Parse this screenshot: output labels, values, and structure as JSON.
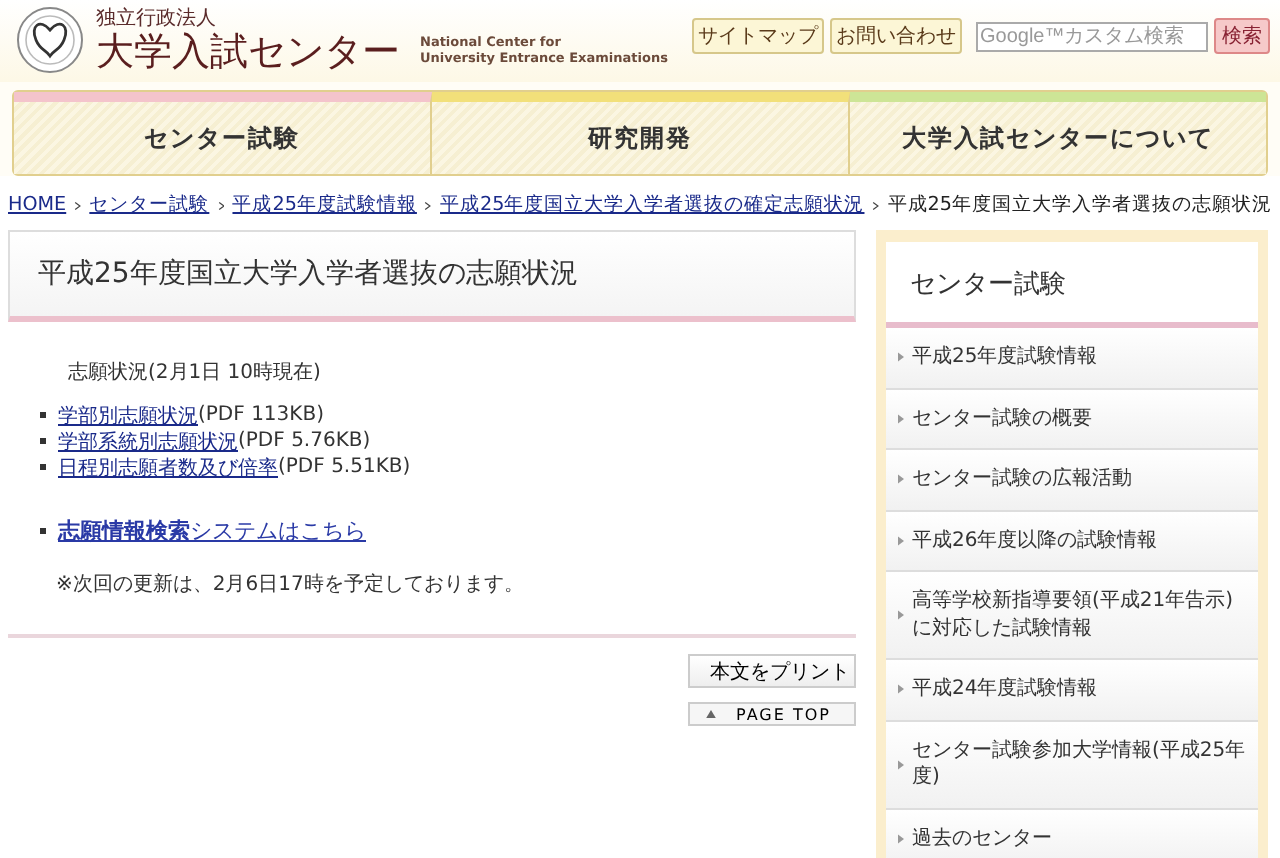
{
  "header": {
    "org_type": "独立行政法人",
    "org_name": "大学入試センター",
    "english_name": [
      "National Center for",
      "University Entrance Examinations"
    ],
    "links": [
      "サイトマップ",
      "お問い合わせ"
    ],
    "search": {
      "placeholder": "Google™カスタム検索",
      "button": "検索"
    }
  },
  "nav": [
    {
      "label": "センター試験",
      "color": "#f4c4cc"
    },
    {
      "label": "研究開発",
      "color": "#f2e07a"
    },
    {
      "label": "大学入試センターについて",
      "color": "#cde596"
    }
  ],
  "breadcrumb": {
    "links": [
      "HOME",
      "センター試験",
      "平成25年度試験情報",
      "平成25年度国立大学入学者選抜の確定志願状況"
    ],
    "current": "平成25年度国立大学入学者選抜の志願状況"
  },
  "main": {
    "title": "平成25年度国立大学入学者選抜の志願状況",
    "status_heading": "志願状況(2月1日 10時現在)",
    "files": [
      {
        "link": "学部別志願状況",
        "size": "(PDF 113KB)"
      },
      {
        "link": "学部系統別志願状況",
        "size": "(PDF 5.76KB)"
      },
      {
        "link": "日程別志願者数及び倍率",
        "size": "(PDF 5.51KB)"
      }
    ],
    "search_link": "**志願情報検索**システムはこちら",
    "note": "※次回の更新は、2月6日17時を予定しております。",
    "print_button": "本文をプリント",
    "page_top": "PAGE TOP"
  },
  "sidebar": {
    "title": "センター試験",
    "items": [
      "平成25年度試験情報",
      "センター試験の概要",
      "センター試験の広報活動",
      "平成26年度以降の試験情報",
      "高等学校新指導要領(平成21年告示)に対応した試験情報",
      "平成24年度試験情報",
      "センター試験参加大学情報(平成25年度)",
      "過去のセンター"
    ]
  }
}
